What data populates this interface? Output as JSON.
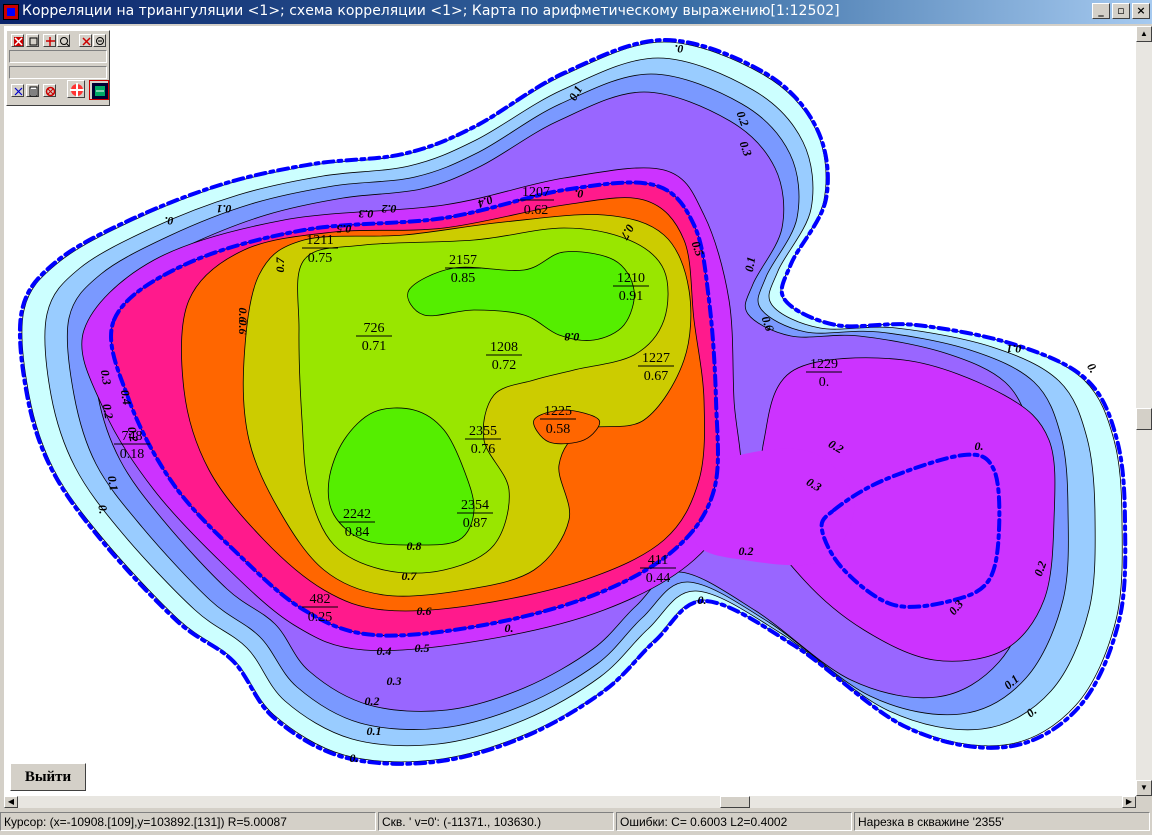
{
  "window": {
    "title": "Корреляции на триангуляции <1>; схема корреляции <1>; Карта по арифметическому выражению[1:12502]",
    "minimize_glyph": "_",
    "restore_glyph": "▫",
    "close_glyph": "×"
  },
  "exit_button_label": "Выйти",
  "status": {
    "cursor": "Курсор: (x=-10908.[109],y=103892.[131]) R=5.00087",
    "well": "Скв. ' v=0': (-11371., 103630.)",
    "errors": "Ошибки: C=  0.6003 L2=0.4002",
    "slice": "Нарезка в скважине '2355'"
  },
  "colors": {
    "level_0": "#ccffff",
    "level_01": "#99ccff",
    "level_02": "#7a99ff",
    "level_03": "#9966ff",
    "level_04": "#cc33ff",
    "level_05": "#ff1a8c",
    "level_06": "#ff6600",
    "level_07": "#cccc00",
    "level_08": "#99e600",
    "level_085": "#55ee00",
    "dash_boundary": "#0000ff"
  },
  "wells": [
    {
      "name": "1211",
      "value": "0.75"
    },
    {
      "name": "1207",
      "value": "0.62"
    },
    {
      "name": "2157",
      "value": "0.85"
    },
    {
      "name": "1210",
      "value": "0.91"
    },
    {
      "name": "726",
      "value": "0.71"
    },
    {
      "name": "1208",
      "value": "0.72"
    },
    {
      "name": "1227",
      "value": "0.67"
    },
    {
      "name": "1229",
      "value": "0."
    },
    {
      "name": "748",
      "value": "0.18"
    },
    {
      "name": "1225",
      "value": "0.58"
    },
    {
      "name": "2355",
      "value": "0.76"
    },
    {
      "name": "2242",
      "value": "0.84"
    },
    {
      "name": "2354",
      "value": "0.87"
    },
    {
      "name": "411",
      "value": "0.44"
    },
    {
      "name": "482",
      "value": "0.25"
    }
  ],
  "contour_labels": [
    "0.",
    "0.1",
    "0.2",
    "0.3",
    "0.4",
    "0.5",
    "0.6",
    "0.7",
    "0.8"
  ]
}
